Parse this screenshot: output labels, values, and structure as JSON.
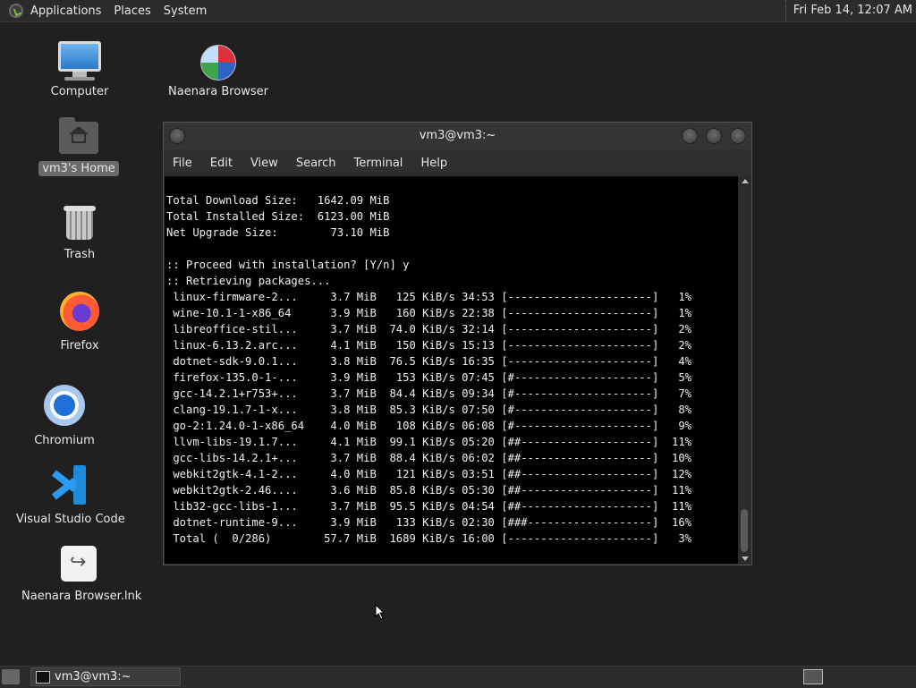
{
  "top_panel": {
    "menus": [
      "Applications",
      "Places",
      "System"
    ],
    "clock": "Fri Feb 14, 12:07 AM"
  },
  "desktop_icons": [
    {
      "label": "Computer",
      "icon": "computer-icon"
    },
    {
      "label": "Naenara Browser",
      "icon": "browser-icon"
    },
    {
      "label": "vm3's Home",
      "icon": "home-folder-icon"
    },
    {
      "label": "Trash",
      "icon": "trash-icon"
    },
    {
      "label": "Firefox",
      "icon": "firefox-icon"
    },
    {
      "label": "Chromium",
      "icon": "chromium-icon"
    },
    {
      "label": "Visual Studio Code",
      "icon": "vscode-icon"
    },
    {
      "label": "Naenara Browser.lnk",
      "icon": "shortcut-icon"
    }
  ],
  "terminal": {
    "title": "vm3@vm3:~",
    "menu": [
      "File",
      "Edit",
      "View",
      "Search",
      "Terminal",
      "Help"
    ],
    "lines": [
      "Total Download Size:   1642.09 MiB",
      "Total Installed Size:  6123.00 MiB",
      "Net Upgrade Size:        73.10 MiB",
      "",
      ":: Proceed with installation? [Y/n] y",
      ":: Retrieving packages...",
      " linux-firmware-2...     3.7 MiB   125 KiB/s 34:53 [----------------------]   1%",
      " wine-10.1-1-x86_64      3.9 MiB   160 KiB/s 22:38 [----------------------]   1%",
      " libreoffice-stil...     3.7 MiB  74.0 KiB/s 32:14 [----------------------]   2%",
      " linux-6.13.2.arc...     4.1 MiB   150 KiB/s 15:13 [----------------------]   2%",
      " dotnet-sdk-9.0.1...     3.8 MiB  76.5 KiB/s 16:35 [----------------------]   4%",
      " firefox-135.0-1-...     3.9 MiB   153 KiB/s 07:45 [#---------------------]   5%",
      " gcc-14.2.1+r753+...     3.7 MiB  84.4 KiB/s 09:34 [#---------------------]   7%",
      " clang-19.1.7-1-x...     3.8 MiB  85.3 KiB/s 07:50 [#---------------------]   8%",
      " go-2:1.24.0-1-x86_64    4.0 MiB   108 KiB/s 06:08 [#---------------------]   9%",
      " llvm-libs-19.1.7...     4.1 MiB  99.1 KiB/s 05:20 [##--------------------]  11%",
      " gcc-libs-14.2.1+...     3.7 MiB  88.4 KiB/s 06:02 [##--------------------]  10%",
      " webkit2gtk-4.1-2...     4.0 MiB   121 KiB/s 03:51 [##--------------------]  12%",
      " webkit2gtk-2.46....     3.6 MiB  85.8 KiB/s 05:30 [##--------------------]  11%",
      " lib32-gcc-libs-1...     3.7 MiB  95.5 KiB/s 04:54 [##--------------------]  11%",
      " dotnet-runtime-9...     3.9 MiB   133 KiB/s 02:30 [###-------------------]  16%",
      " Total (  0/286)        57.7 MiB  1689 KiB/s 16:00 [----------------------]   3%"
    ]
  },
  "taskbar": {
    "task_label": "vm3@vm3:~"
  }
}
